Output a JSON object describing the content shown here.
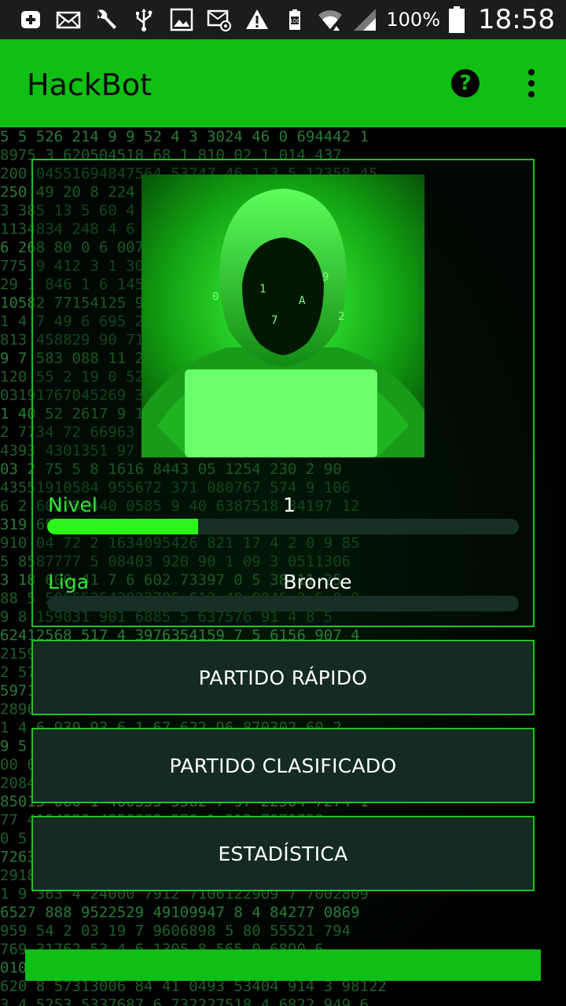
{
  "status_bar": {
    "battery_percent": "100%",
    "time": "18:58",
    "icons": [
      "add-box-icon",
      "mail-icon",
      "wrench-icon",
      "usb-icon",
      "image-icon",
      "email-at-icon",
      "warning-icon",
      "battery-saver-icon",
      "wifi-icon",
      "signal-icon",
      "battery-icon"
    ]
  },
  "app_bar": {
    "title": "HackBot",
    "help_icon": "help-circle-icon",
    "more_icon": "more-vert-icon",
    "color": "#0fbf14"
  },
  "profile": {
    "level_label": "Nivel",
    "level_value": "1",
    "level_progress": 0.32,
    "league_label": "Liga",
    "league_value": "Bronce",
    "league_progress": 0
  },
  "buttons": {
    "quick_match": "PARTIDO RÁPIDO",
    "ranked_match": "PARTIDO CLASIFICADO",
    "statistics": "ESTADÍSTICA"
  },
  "colors": {
    "accent": "#1fc11f",
    "progress": "#2cf51c",
    "button_bg": "#142b22"
  }
}
